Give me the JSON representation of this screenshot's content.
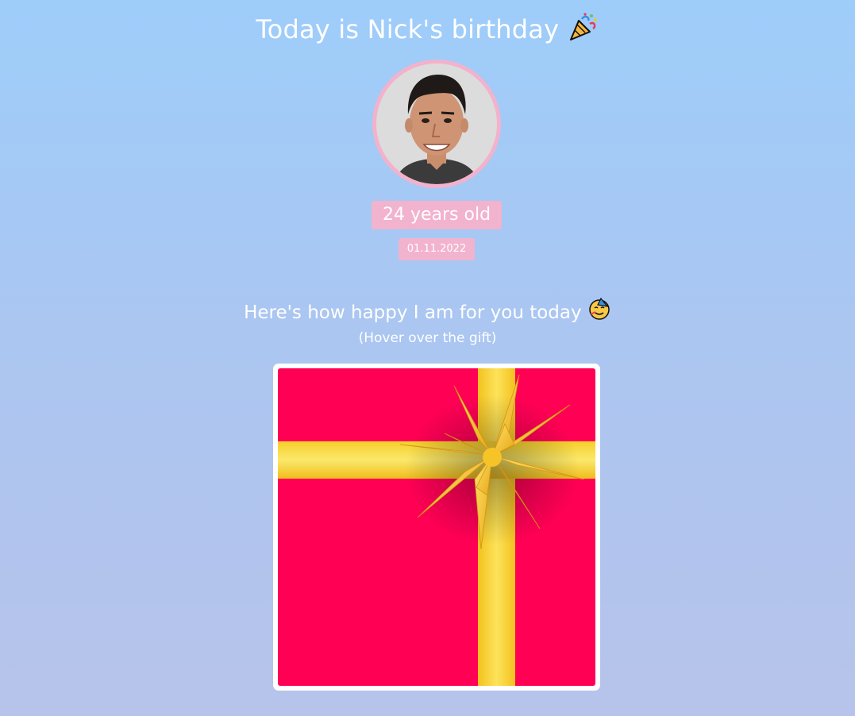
{
  "header": {
    "title": "Today is Nick's birthday",
    "title_emoji_icon": "party-popper-icon"
  },
  "profile": {
    "avatar_icon": "person-photo",
    "age_label": "24 years old",
    "date": "01.11.2022"
  },
  "message": {
    "heading": "Here's how happy I am for you today",
    "heading_emoji_icon": "partying-face-icon",
    "hint": "(Hover over the gift)"
  },
  "gift": {
    "icon": "gift-box-icon"
  },
  "colors": {
    "background_top": "#9ecdfa",
    "background_bottom": "#b7c3ea",
    "badge": "#f2b3ce",
    "gift_box": "#ff0055",
    "ribbon": "#f9d43a"
  }
}
